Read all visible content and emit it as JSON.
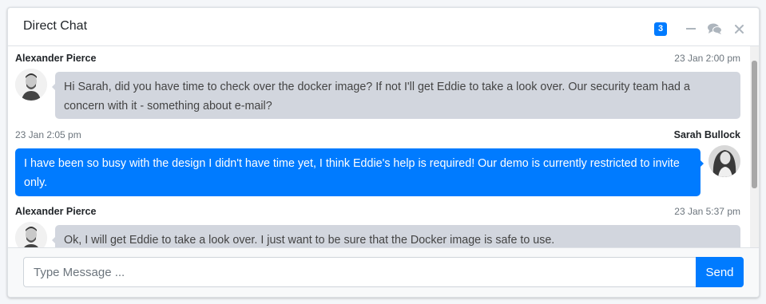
{
  "header": {
    "title": "Direct Chat",
    "badge_count": "3",
    "icons": [
      "minus-icon",
      "comments-icon",
      "close-icon"
    ]
  },
  "messages": [
    {
      "side": "left",
      "name": "Alexander Pierce",
      "time": "23 Jan 2:00 pm",
      "text": "Hi Sarah, did you have time to check over the docker image? If not I'll get Eddie to take a look over. Our security team had a concern with it - something about e-mail?"
    },
    {
      "side": "right",
      "name": "Sarah Bullock",
      "time": "23 Jan 2:05 pm",
      "text": "I have been so busy with the design I didn't have time yet, I think Eddie's help is required! Our demo is currently restricted to invite only."
    },
    {
      "side": "left",
      "name": "Alexander Pierce",
      "time": "23 Jan 5:37 pm",
      "text": "Ok, I will get Eddie to take a look over. I just want to be sure that the Docker image is safe to use."
    }
  ],
  "footer": {
    "input_placeholder": "Type Message ...",
    "input_value": "",
    "send_label": "Send"
  },
  "colors": {
    "primary": "#007bff",
    "bubble_left": "#d2d6de",
    "muted_text": "#6c757d"
  }
}
